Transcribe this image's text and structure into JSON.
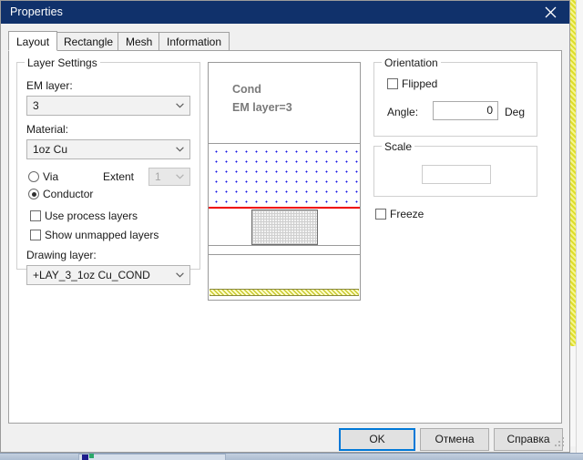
{
  "window": {
    "title": "Properties",
    "close_icon": "close-icon"
  },
  "tabs": [
    {
      "label": "Layout",
      "active": true
    },
    {
      "label": "Rectangle",
      "active": false
    },
    {
      "label": "Mesh",
      "active": false
    },
    {
      "label": "Information",
      "active": false
    }
  ],
  "layer_settings": {
    "group_title": "Layer Settings",
    "em_layer_label": "EM layer:",
    "em_layer_value": "3",
    "material_label": "Material:",
    "material_value": "1oz Cu",
    "via_radio_label": "Via",
    "conductor_radio_label": "Conductor",
    "extent_label": "Extent",
    "extent_value": "1",
    "use_process_layers_label": "Use process layers",
    "show_unmapped_layers_label": "Show unmapped layers",
    "drawing_layer_label": "Drawing layer:",
    "drawing_layer_value": "+LAY_3_1oz Cu_COND"
  },
  "preview": {
    "line1": "Cond",
    "line2": "EM layer=3",
    "dot_color": "#1414e6",
    "interface_color": "#ee0000",
    "ground_color": "#c8c82e"
  },
  "orientation": {
    "group_title": "Orientation",
    "flipped_label": "Flipped",
    "angle_label": "Angle:",
    "angle_value": "0",
    "angle_unit": "Deg"
  },
  "scale": {
    "group_title": "Scale",
    "value": ""
  },
  "freeze": {
    "label": "Freeze"
  },
  "buttons": {
    "ok": "OK",
    "cancel": "Отмена",
    "help": "Справка"
  },
  "theme": {
    "titlebar_bg": "#10316b",
    "accent": "#0078d7",
    "dialog_bg": "#f0f0f0"
  }
}
